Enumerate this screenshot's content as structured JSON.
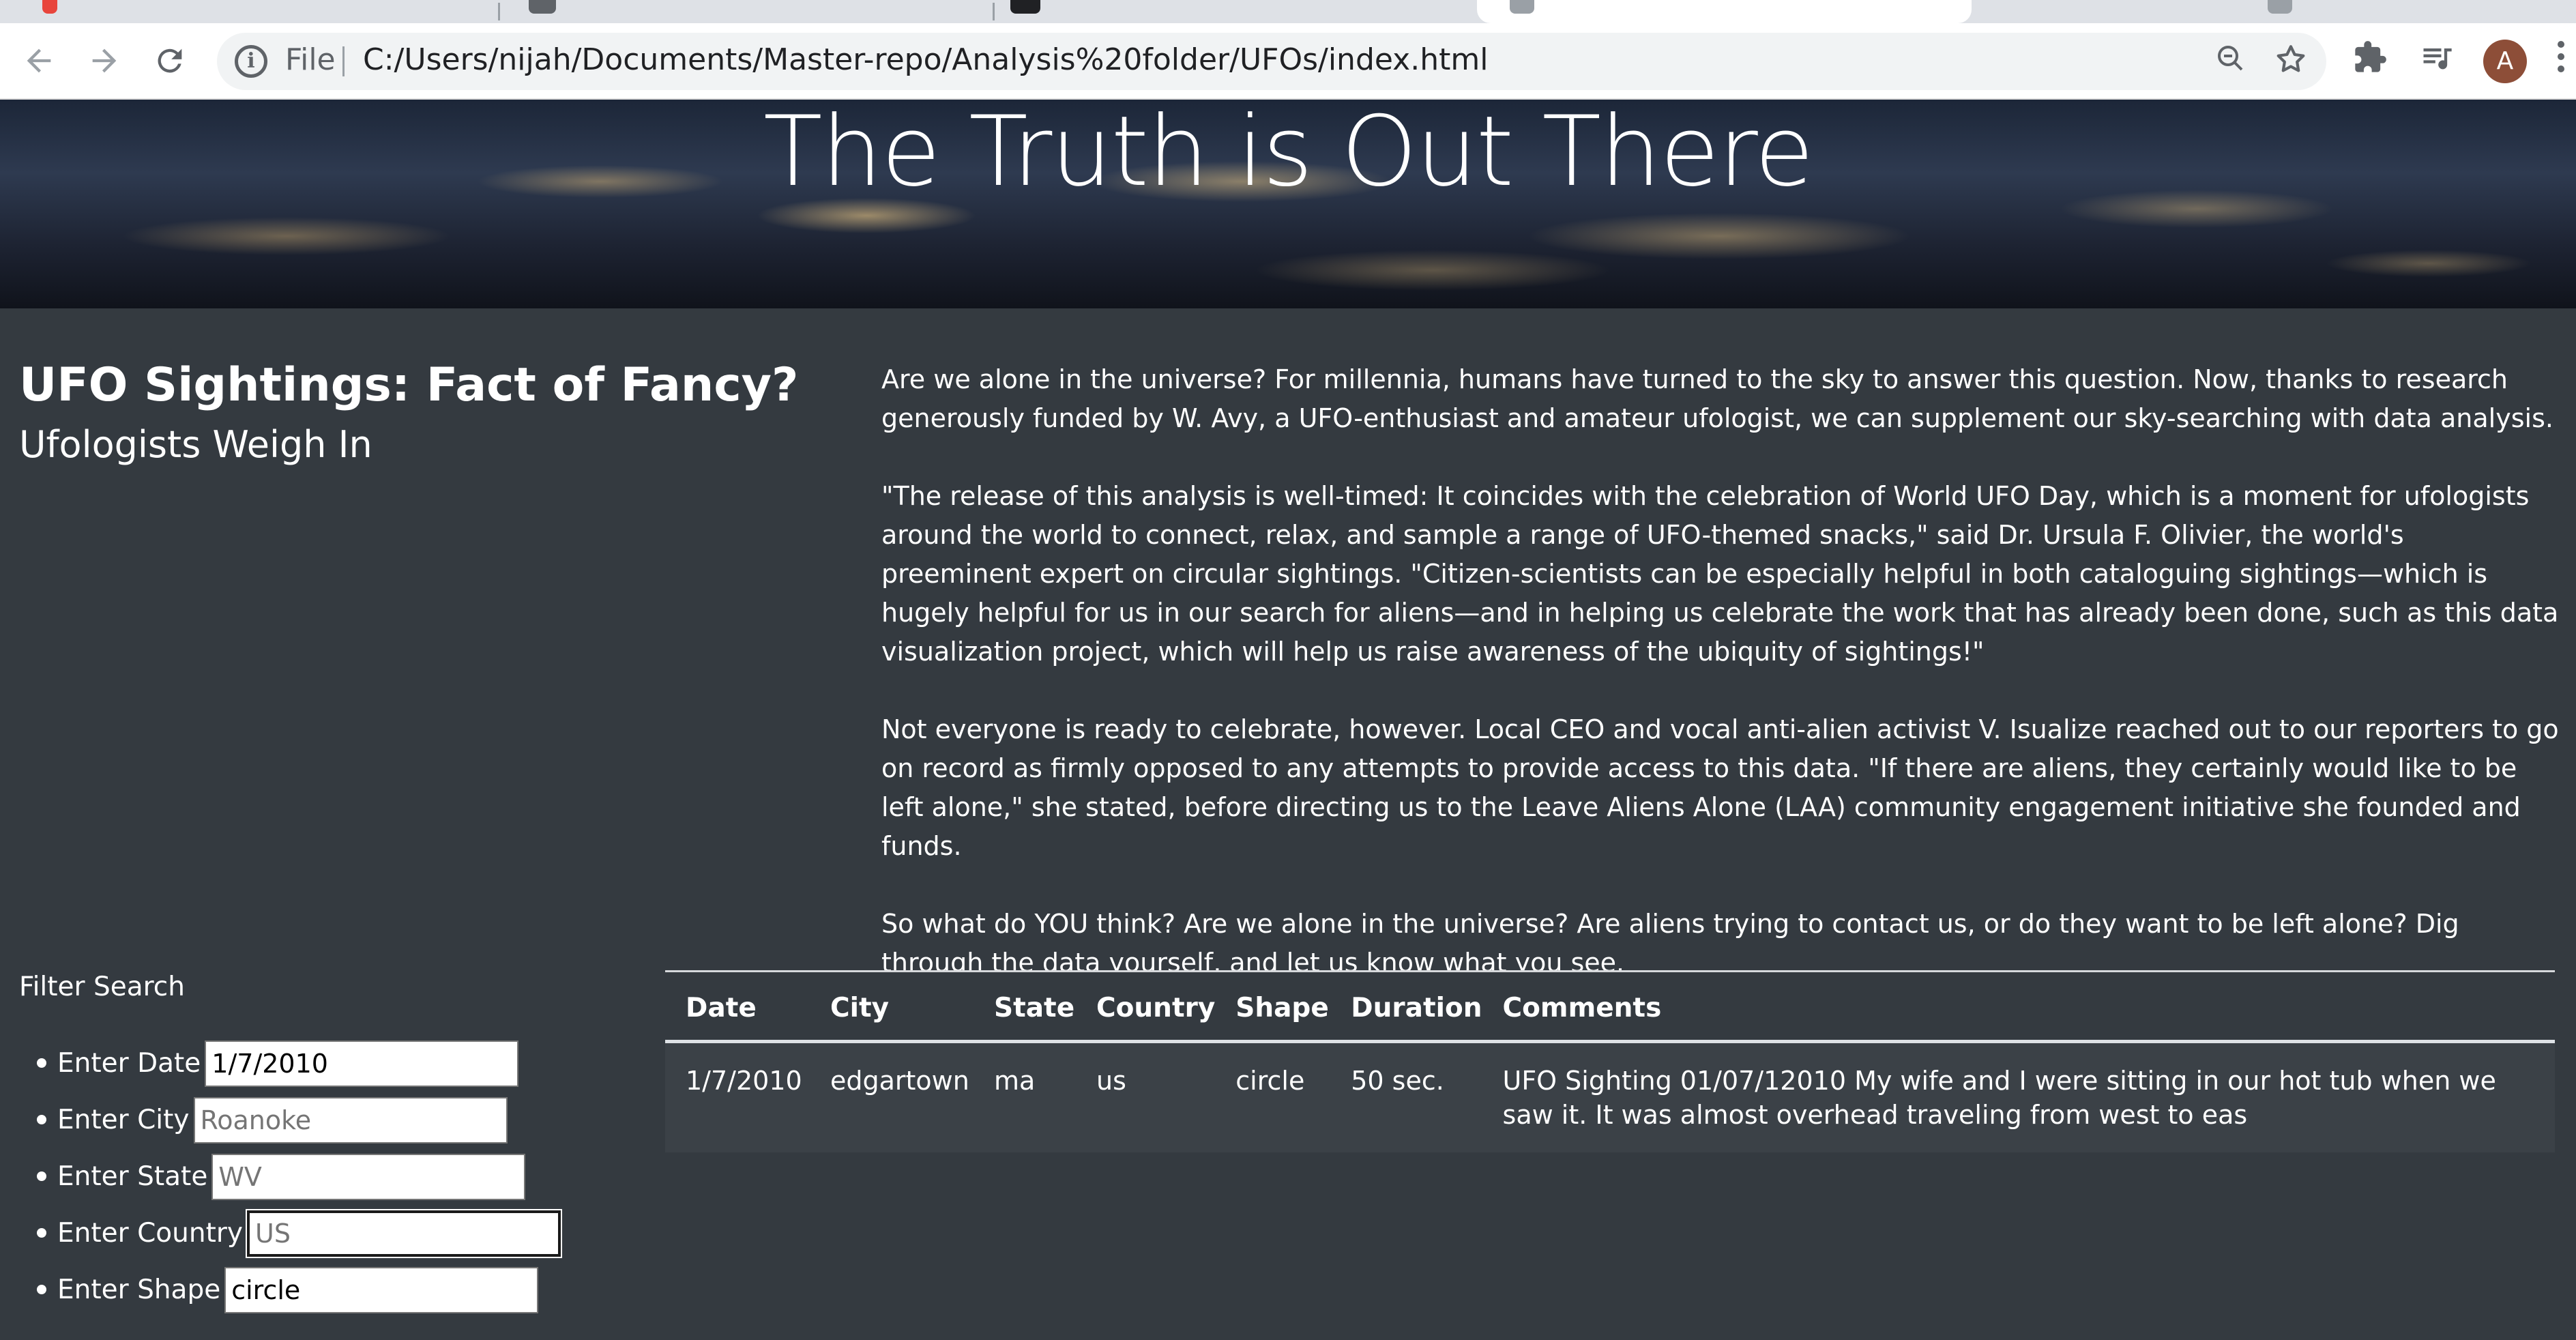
{
  "browser": {
    "omnibox": {
      "scheme_label": "File",
      "url": "C:/Users/nijah/Documents/Master-repo/Analysis%20folder/UFOs/index.html"
    },
    "icons": {
      "back": "back-arrow-icon",
      "forward": "forward-arrow-icon",
      "reload": "reload-icon",
      "info": "info-icon",
      "zoom": "zoom-out-icon",
      "bookmark": "star-icon",
      "extensions": "puzzle-icon",
      "media": "media-queue-icon",
      "menu": "kebab-menu-icon"
    },
    "profile_initial": "A"
  },
  "hero": {
    "title": "The Truth is Out There"
  },
  "headline": {
    "main": "UFO Sightings: Fact of Fancy?",
    "sub": "Ufologists Weigh In"
  },
  "article": {
    "paragraphs": [
      "Are we alone in the universe? For millennia, humans have turned to the sky to answer this question. Now, thanks to research generously funded by W. Avy, a UFO-enthusiast and amateur ufologist, we can supplement our sky-searching with data analysis.",
      "\"The release of this analysis is well-timed: It coincides with the celebration of World UFO Day, which is a moment for ufologists around the world to connect, relax, and sample a range of UFO-themed snacks,\" said Dr. Ursula F. Olivier, the world's preeminent expert on circular sightings. \"Citizen-scientists can be especially helpful in both cataloguing sightings—which is hugely helpful for us in our search for aliens—and in helping us celebrate the work that has already been done, such as this data visualization project, which will help us raise awareness of the ubiquity of sightings!\"",
      "Not everyone is ready to celebrate, however. Local CEO and vocal anti-alien activist V. Isualize reached out to our reporters to go on record as firmly opposed to any attempts to provide access to this data. \"If there are aliens, they certainly would like to be left alone,\" she stated, before directing us to the Leave Aliens Alone (LAA) community engagement initiative she founded and funds.",
      "So what do YOU think? Are we alone in the universe? Are aliens trying to contact us, or do they want to be left alone? Dig through the data yourself, and let us know what you see."
    ]
  },
  "filters": {
    "title": "Filter Search",
    "items": [
      {
        "label": "Enter Date",
        "value": "1/7/2010",
        "placeholder": ""
      },
      {
        "label": "Enter City",
        "value": "",
        "placeholder": "Roanoke"
      },
      {
        "label": "Enter State",
        "value": "",
        "placeholder": "WV"
      },
      {
        "label": "Enter Country",
        "value": "",
        "placeholder": "US"
      },
      {
        "label": "Enter Shape",
        "value": "circle",
        "placeholder": ""
      }
    ]
  },
  "table": {
    "headers": [
      "Date",
      "City",
      "State",
      "Country",
      "Shape",
      "Duration",
      "Comments"
    ],
    "rows": [
      [
        "1/7/2010",
        "edgartown",
        "ma",
        "us",
        "circle",
        "50 sec.",
        "UFO Sighting 01/07/12010 My wife and I were sitting in our hot tub when we saw it. It was almost overhead traveling from west to eas"
      ]
    ]
  },
  "colors": {
    "page_background": "#343a40",
    "table_row_background": "#3b4147",
    "text": "#ffffff",
    "omnibox_background": "#f1f3f4",
    "avatar": "#8d4e38"
  }
}
